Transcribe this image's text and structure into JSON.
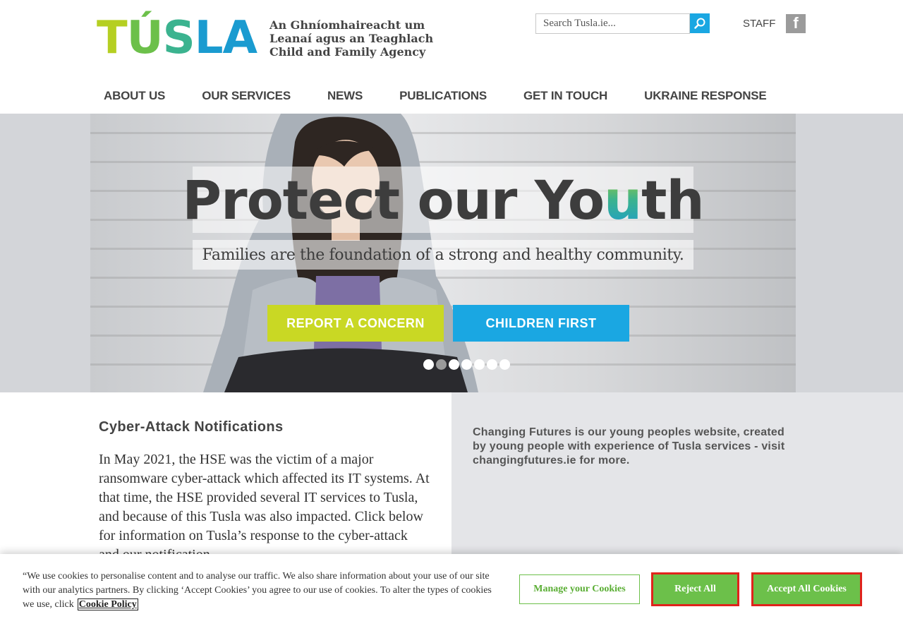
{
  "header": {
    "logo": {
      "wordmark": "TUSLA",
      "tagline": [
        "An Ghníomhaireacht um",
        "Leanaí agus an Teaghlach",
        "Child and Family Agency"
      ]
    },
    "search": {
      "placeholder": "Search Tusla.ie..."
    },
    "staff_label": "STAFF",
    "facebook_label": "f"
  },
  "nav": {
    "items": [
      {
        "label": "ABOUT US"
      },
      {
        "label": "OUR SERVICES"
      },
      {
        "label": "NEWS"
      },
      {
        "label": "PUBLICATIONS"
      },
      {
        "label": "GET IN TOUCH"
      },
      {
        "label": "UKRAINE RESPONSE"
      }
    ]
  },
  "hero": {
    "title_part1": "Protect our Yo",
    "title_u": "u",
    "title_part2": "th",
    "subtitle": "Families are the foundation of a strong and healthy community.",
    "report_button": "REPORT A CONCERN",
    "children_button": "CHILDREN FIRST",
    "slide_count": 7,
    "active_slide": 2
  },
  "main": {
    "cyber_title": "Cyber-Attack Notifications",
    "cyber_body": "In May 2021, the HSE was the victim of a major ransomware cyber-attack which affected its IT systems. At that time, the HSE provided several IT services to Tusla, and because of this Tusla was also impacted. Click below for information on Tusla’s response to the cyber-attack and our notification",
    "changing_futures": "Changing Futures is our young peoples website, created by young people with experience of Tusla services - visit changingfutures.ie for more."
  },
  "cookie": {
    "text": "“We use cookies to personalise content and to analyse our traffic. We also share information about your use of our site with our analytics partners. By clicking ‘Accept Cookies’ you agree to our use of cookies. To alter the types of cookies we use, click",
    "policy_link": "Cookie Policy",
    "manage_button": "Manage your Cookies",
    "reject_button": "Reject All",
    "accept_button": "Accept All Cookies"
  },
  "colors": {
    "brand_green": "#6cc04a",
    "brand_lime": "#c9d824",
    "brand_blue": "#1aa7e2",
    "highlight_red": "#e0231c"
  }
}
